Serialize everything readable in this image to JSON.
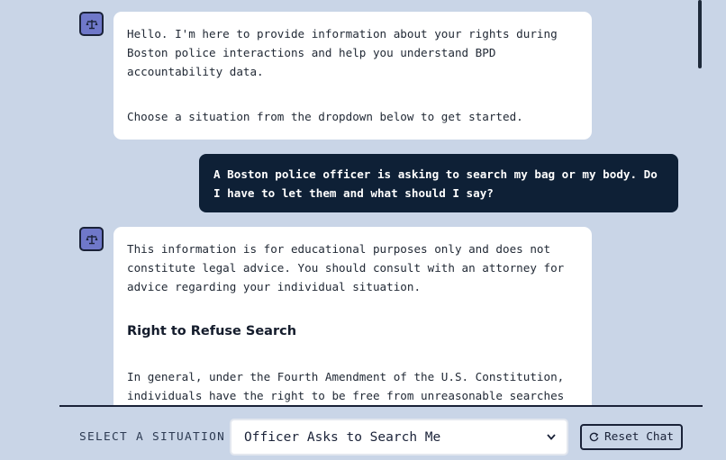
{
  "chat": {
    "messages": [
      {
        "role": "assistant",
        "paragraphs": [
          "Hello. I'm here to provide information about your rights during Boston police interactions and help you understand BPD accountability data.",
          "Choose a situation from the dropdown below to get started."
        ]
      },
      {
        "role": "user",
        "text": "A Boston police officer is asking to search my bag or my body. Do I have to let them and what should I say?"
      },
      {
        "role": "assistant",
        "disclaimer": "This information is for educational purposes only and does not constitute legal advice. You should consult with an attorney for advice regarding your individual situation.",
        "heading": "Right to Refuse Search",
        "body": "In general, under the Fourth Amendment of the U.S. Constitution, individuals have the right to be free from unreasonable searches and"
      }
    ]
  },
  "controls": {
    "situation_label": "SELECT A SITUATION",
    "selected_situation": "Officer Asks to Search Me",
    "reset_label": "Reset Chat"
  },
  "icons": {
    "avatar": "scales-of-justice-icon",
    "select": "chevron-down-icon",
    "reset": "refresh-icon"
  },
  "colors": {
    "background": "#c9d5e7",
    "user_bubble": "#0e2036",
    "avatar": "#6f78c9"
  }
}
